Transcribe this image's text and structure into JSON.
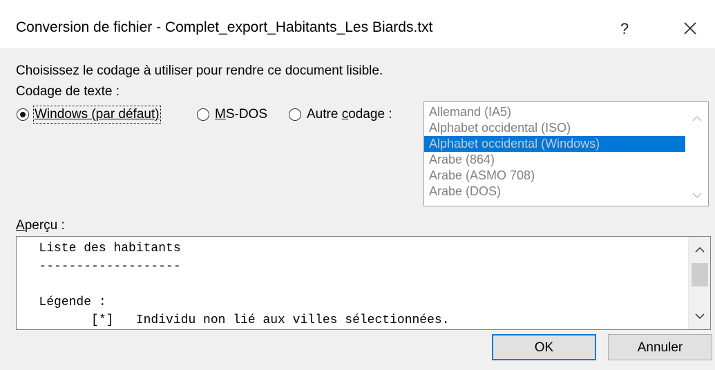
{
  "window": {
    "title": "Conversion de fichier - Complet_export_Habitants_Les Biards.txt",
    "help_glyph": "?",
    "close_icon": "close-icon"
  },
  "instruction": "Choisissez le codage à utiliser pour rendre ce document lisible.",
  "encoding_label": "Codage de texte :",
  "radios": [
    {
      "label": "Windows (par défaut)",
      "checked": true
    },
    {
      "label_pre": "",
      "label_u": "M",
      "label_post": "S-DOS",
      "checked": false
    },
    {
      "label_pre": "Autre ",
      "label_u": "c",
      "label_post": "odage :",
      "checked": false
    }
  ],
  "encoding_list": {
    "items": [
      "Allemand (IA5)",
      "Alphabet occidental (ISO)",
      "Alphabet occidental (Windows)",
      "Arabe (864)",
      "Arabe (ASMO 708)",
      "Arabe (DOS)"
    ],
    "selected": "Alphabet occidental (Windows)",
    "selected_color": "#0078d7"
  },
  "preview": {
    "label_u": "A",
    "label_rest": "perçu :",
    "lines": [
      "   Liste des habitants",
      "   -------------------",
      "",
      "   Légende :",
      "          [*]   Individu non lié aux villes sélectionnées."
    ]
  },
  "buttons": {
    "ok": "OK",
    "cancel": "Annuler"
  },
  "colors": {
    "accent": "#0078d7",
    "dialog_bg": "#f0f0f0"
  }
}
